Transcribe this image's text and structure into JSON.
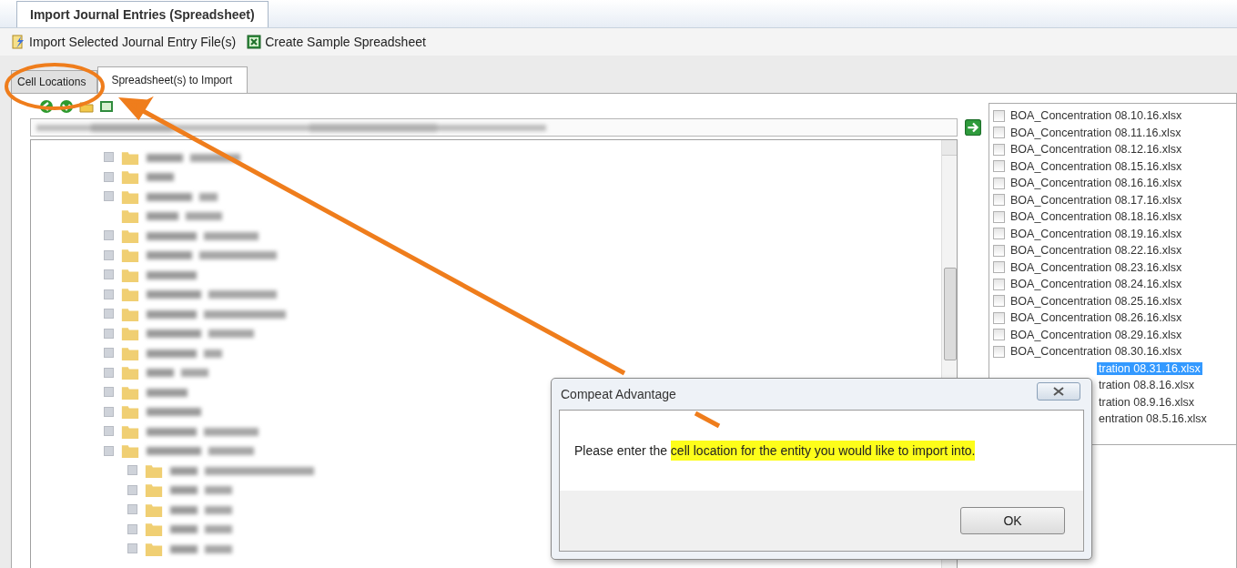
{
  "document_tabs": [
    {
      "label": "Import Journal Entries (Spreadsheet)",
      "selected": true
    }
  ],
  "toolbar": [
    {
      "kind": "import",
      "label": "Import Selected Journal Entry File(s)"
    },
    {
      "kind": "excel",
      "label": "Create Sample Spreadsheet"
    }
  ],
  "tabs": [
    {
      "label": "Cell Locations",
      "selected": false
    },
    {
      "label": "Spreadsheet(s) to Import",
      "selected": true
    }
  ],
  "files": [
    {
      "name": "BOA_Concentration 08.10.16.xlsx",
      "checked": false,
      "selected": false
    },
    {
      "name": "BOA_Concentration 08.11.16.xlsx",
      "checked": false,
      "selected": false
    },
    {
      "name": "BOA_Concentration 08.12.16.xlsx",
      "checked": false,
      "selected": false
    },
    {
      "name": "BOA_Concentration 08.15.16.xlsx",
      "checked": false,
      "selected": false
    },
    {
      "name": "BOA_Concentration 08.16.16.xlsx",
      "checked": false,
      "selected": false
    },
    {
      "name": "BOA_Concentration 08.17.16.xlsx",
      "checked": false,
      "selected": false
    },
    {
      "name": "BOA_Concentration 08.18.16.xlsx",
      "checked": false,
      "selected": false
    },
    {
      "name": "BOA_Concentration 08.19.16.xlsx",
      "checked": false,
      "selected": false
    },
    {
      "name": "BOA_Concentration 08.22.16.xlsx",
      "checked": false,
      "selected": false
    },
    {
      "name": "BOA_Concentration 08.23.16.xlsx",
      "checked": false,
      "selected": false
    },
    {
      "name": "BOA_Concentration 08.24.16.xlsx",
      "checked": false,
      "selected": false
    },
    {
      "name": "BOA_Concentration 08.25.16.xlsx",
      "checked": false,
      "selected": false
    },
    {
      "name": "BOA_Concentration 08.26.16.xlsx",
      "checked": false,
      "selected": false
    },
    {
      "name": "BOA_Concentration 08.29.16.xlsx",
      "checked": false,
      "selected": false
    },
    {
      "name": "BOA_Concentration 08.30.16.xlsx",
      "checked": false,
      "selected": false
    },
    {
      "name": "tration 08.31.16.xlsx",
      "kind": "partial",
      "selected": true
    },
    {
      "name": "tration 08.8.16.xlsx",
      "kind": "partial",
      "selected": false
    },
    {
      "name": "tration 08.9.16.xlsx",
      "kind": "partial",
      "selected": false
    },
    {
      "name": "entration 08.5.16.xlsx",
      "kind": "partial",
      "selected": false
    }
  ],
  "dialog": {
    "title": "Compeat Advantage",
    "message": "Please enter the ",
    "message_highlight": "cell location for the entity you would like to import into.",
    "buttons": [
      "OK"
    ]
  }
}
